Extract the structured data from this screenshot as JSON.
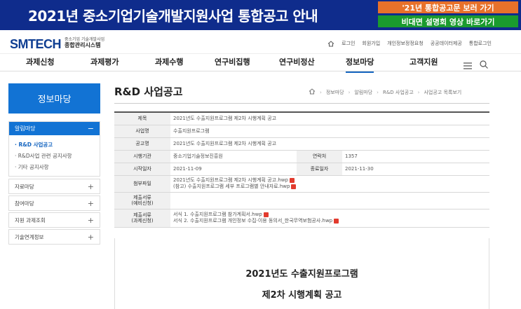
{
  "banner": {
    "title": "2021년 중소기업기술개발지원사업 통합공고 안내",
    "btn1": "'21년 통합공고문 보러 가기",
    "btn2": "비대면 설명회 영상 바로가기",
    "btn1_color": "#e8712a",
    "btn2_color": "#1a9b2e"
  },
  "header": {
    "logo": "SMTECH",
    "logo_sub1": "중소기업 기술개발사업",
    "logo_sub2": "종합관리시스템",
    "util": [
      "로그인",
      "회원가입",
      "개인정보정정요청",
      "공공데이터제공",
      "통합로그인"
    ]
  },
  "gnb": {
    "items": [
      "과제신청",
      "과제평가",
      "과제수행",
      "연구비집행",
      "연구비정산",
      "정보마당",
      "고객지원"
    ],
    "active_index": 5,
    "accent": "#1565c0"
  },
  "sidebar": {
    "title": "정보마당",
    "group_label": "알림마당",
    "group_toggle": "−",
    "sub_items": [
      "· R&D 사업공고",
      "· R&D사업 관련 공지사항",
      "· 기타 공지사항"
    ],
    "items": [
      "자료마당",
      "참여마당",
      "지원 과제조회",
      "기술연계정보"
    ],
    "plus": "+"
  },
  "content": {
    "title": "R&D 사업공고",
    "breadcrumb": [
      "정보마당",
      "알림마당",
      "R&D 사업공고",
      "사업공고 목록보기"
    ]
  },
  "info": {
    "labels": {
      "title": "제목",
      "program": "사업명",
      "notice": "공고명",
      "agency": "시행기관",
      "contact": "연락처",
      "start": "시작일자",
      "end": "종료일자",
      "attach": "첨부파일",
      "submit1": "제출서류\n(예비신청)",
      "submit2": "제출서류\n(과제신청)"
    },
    "title": "2021년도 수출지원프로그램 제2차 시행계획 공고",
    "program": "수출지원프로그램",
    "notice": "2021년도 수출지원프로그램 제2차 시행계획 공고",
    "agency": "중소기업기술정보진흥원",
    "contact": "1357",
    "start": "2021-11-09",
    "end": "2021-11-30",
    "attach": [
      "2021년도 수출지원프로그램 제2차 시행계획 공고.hwp",
      "(참고) 수출지원프로그램 세부 프로그램별 안내자료.hwp"
    ],
    "submit1": "",
    "submit2": [
      "서식 1. 수출지원프로그램 참가계획서.hwp",
      "서식 2. 수출지원프로그램 개인정보 수집·이용 동의서_한국무역보험공사.hwp"
    ]
  },
  "doc": {
    "line1": "2021년도 수출지원프로그램",
    "line2": "제2차 시행계획 공고"
  }
}
